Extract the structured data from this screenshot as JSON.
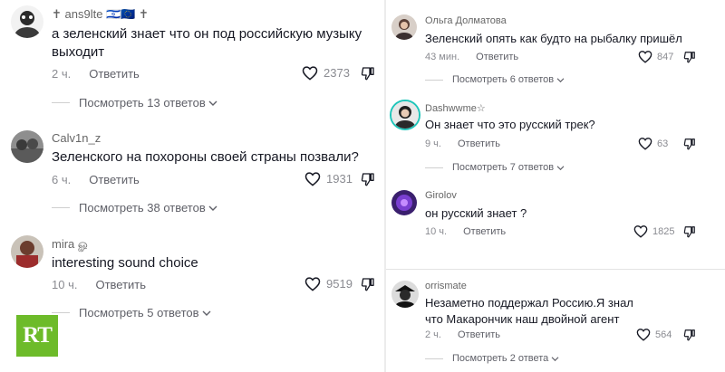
{
  "colors": {
    "heart": "#161823",
    "logo": "#6dbb2a",
    "verified_ring": "#20c5ba"
  },
  "left": [
    {
      "user": "✝ ans9lte 🇮🇱🇪🇺 ✝",
      "text": "а зеленский знает что он под российскую музыку выходит",
      "time": "2 ч.",
      "reply": "Ответить",
      "likes": "2373",
      "replies": "Посмотреть 13 ответов"
    },
    {
      "user": "Calv1n_z",
      "text": "Зеленского на похороны своей страны позвали?",
      "time": "6 ч.",
      "reply": "Ответить",
      "likes": "1931",
      "replies": "Посмотреть 38 ответов"
    },
    {
      "user": "mira ௐ",
      "text": "interesting sound choice",
      "time": "10 ч.",
      "reply": "Ответить",
      "likes": "9519",
      "replies": "Посмотреть 5 ответов"
    }
  ],
  "right": [
    {
      "user": "Ольга Долматова",
      "text": "Зеленский опять как будто на рыбалку пришёл",
      "time": "43 мин.",
      "reply": "Ответить",
      "likes": "847",
      "replies": "Посмотреть 6 ответов"
    },
    {
      "user": "Dashwwme☆",
      "text": "Он знает что это русский трек?",
      "time": "9 ч.",
      "reply": "Ответить",
      "likes": "63",
      "replies": "Посмотреть 7 ответов"
    },
    {
      "user": "Girolov",
      "text": "он русский знает ?",
      "time": "10 ч.",
      "reply": "Ответить",
      "likes": "1825"
    },
    {
      "user": "orrismate",
      "text": "Незаметно поддержал Россию.Я знал что Макарончик наш двойной агент",
      "time": "2 ч.",
      "reply": "Ответить",
      "likes": "564",
      "replies": "Посмотреть 2 ответа"
    }
  ],
  "logo": {
    "text": "RT"
  }
}
